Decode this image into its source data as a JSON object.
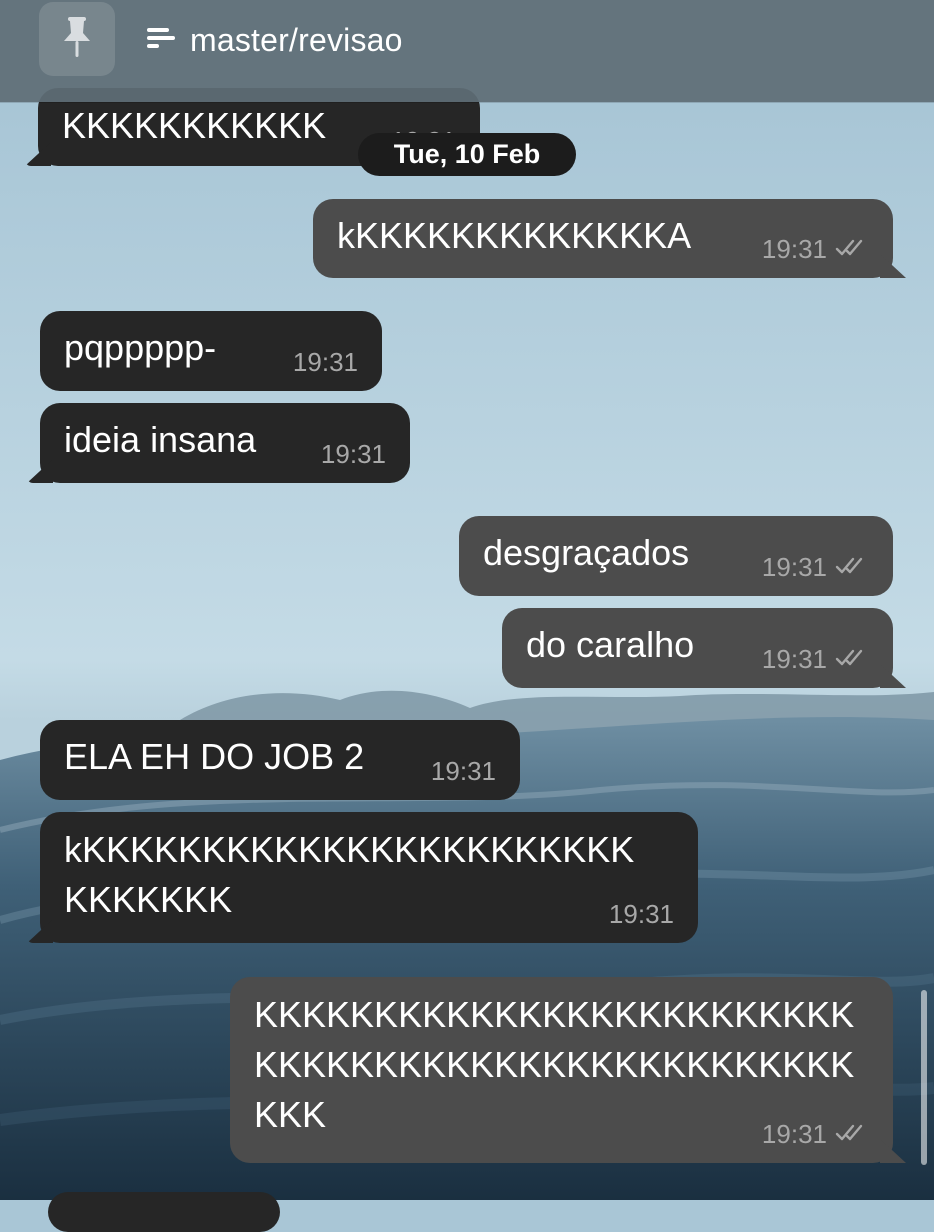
{
  "header": {
    "title": "master/revisao",
    "pin_icon": "pin-icon",
    "topic_icon": "topic-lines-icon"
  },
  "date_separator": "Tue, 10 Feb",
  "messages": [
    {
      "text": "KKKKKKKKKKK",
      "time": "19:31",
      "direction": "incoming"
    },
    {
      "text": "kKKKKKKKKKKKKKA",
      "time": "19:31",
      "direction": "outgoing",
      "read": true
    },
    {
      "text": "pqppppp-",
      "time": "19:31",
      "direction": "incoming"
    },
    {
      "text": "ideia insana",
      "time": "19:31",
      "direction": "incoming"
    },
    {
      "text": "desgraçados",
      "time": "19:31",
      "direction": "outgoing",
      "read": true
    },
    {
      "text": "do caralho",
      "time": "19:31",
      "direction": "outgoing",
      "read": true
    },
    {
      "text": "ELA EH DO JOB 2",
      "time": "19:31",
      "direction": "incoming"
    },
    {
      "line1": "kKKKKKKKKKKKKKKKKKKKKKKK",
      "line2": "KKKKKKK",
      "time": "19:31",
      "direction": "incoming"
    },
    {
      "line1": "KKKKKKKKKKKKKKKKKKKKKKKKK",
      "line2": "KKKKKKKKKKKKKKKKKKKKKKKKK",
      "line3": "KKK",
      "time": "19:31",
      "direction": "outgoing",
      "read": true
    }
  ],
  "colors": {
    "header_bg": "#5f6e76",
    "incoming_bubble": "#262626",
    "outgoing_bubble": "#4c4c4c",
    "timestamp": "#a8a8a8"
  }
}
